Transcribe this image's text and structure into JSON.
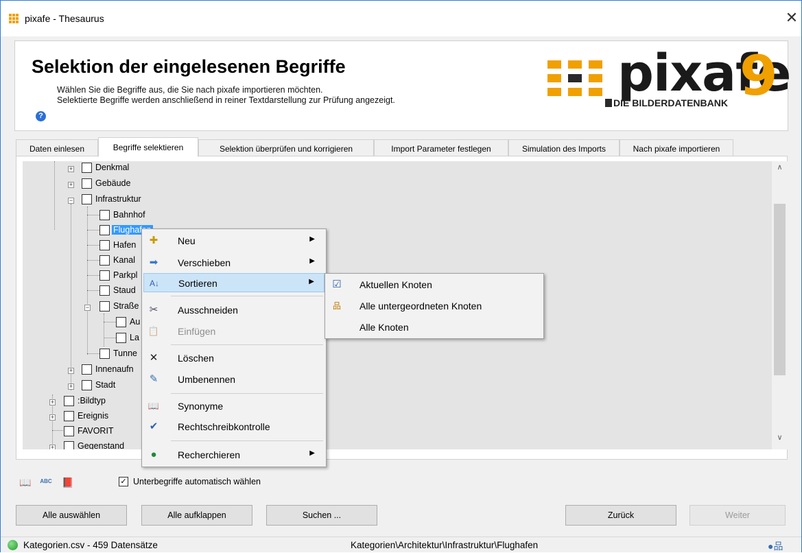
{
  "window": {
    "title": "pixafe - Thesaurus",
    "close_symbol": "✕"
  },
  "header": {
    "title": "Selektion der eingelesenen Begriffe",
    "description_line1": "Wählen Sie die Begriffe aus, die Sie nach pixafe importieren möchten.",
    "description_line2": "Selektierte Begriffe werden anschließend in reiner Textdarstellung zur Prüfung angezeigt.",
    "help_symbol": "?",
    "logo_word": "pixafe",
    "logo_number": "9",
    "logo_subtitle": "DIE BILDERDATENBANK"
  },
  "tabs": [
    {
      "label": "Daten einlesen"
    },
    {
      "label": "Begriffe selektieren",
      "active": true
    },
    {
      "label": "Selektion überprüfen und korrigieren"
    },
    {
      "label": "Import Parameter festlegen"
    },
    {
      "label": "Simulation des Imports"
    },
    {
      "label": "Nach pixafe importieren"
    }
  ],
  "tree": {
    "nodes": [
      {
        "label": "Denkmal",
        "checked": false
      },
      {
        "label": "Gebäude",
        "checked": false
      },
      {
        "label": "Infrastruktur",
        "checked": false
      },
      {
        "label": "Bahnhof",
        "checked": false
      },
      {
        "label": "Flughafen",
        "checked": false,
        "selected": true
      },
      {
        "label": "Hafen",
        "checked": false
      },
      {
        "label": "Kanal",
        "checked": false
      },
      {
        "label": "Parkpl",
        "checked": false
      },
      {
        "label": "Staud",
        "checked": false
      },
      {
        "label": "Straße",
        "checked": false
      },
      {
        "label": "Au",
        "checked": false
      },
      {
        "label": "La",
        "checked": false
      },
      {
        "label": "Tunne",
        "checked": false
      },
      {
        "label": "Innenaufn",
        "checked": false
      },
      {
        "label": "Stadt",
        "checked": false
      },
      {
        "label": ":Bildtyp",
        "checked": false
      },
      {
        "label": "Ereignis",
        "checked": false
      },
      {
        "label": "FAVORIT",
        "checked": false
      },
      {
        "label": "Gegenstand",
        "checked": false
      }
    ]
  },
  "context_menu": {
    "items": [
      {
        "label": "Neu",
        "icon": "new-node-icon",
        "glyph": "✚",
        "submenu": true
      },
      {
        "label": "Verschieben",
        "icon": "move-arrow-icon",
        "glyph": "➡",
        "submenu": true
      },
      {
        "label": "Sortieren",
        "icon": "sort-az-icon",
        "glyph": "A↓",
        "submenu": true,
        "highlighted": true
      },
      {
        "label": "Ausschneiden",
        "icon": "scissors-icon",
        "glyph": "✂"
      },
      {
        "label": "Einfügen",
        "icon": "paste-icon",
        "glyph": "📋",
        "disabled": true
      },
      {
        "label": "Löschen",
        "icon": "delete-x-icon",
        "glyph": "✕"
      },
      {
        "label": "Umbenennen",
        "icon": "rename-pencil-icon",
        "glyph": "✎"
      },
      {
        "label": "Synonyme",
        "icon": "book-icon",
        "glyph": "📖"
      },
      {
        "label": "Rechtschreibkontrolle",
        "icon": "spellcheck-icon",
        "glyph": "✔"
      },
      {
        "label": "Recherchieren",
        "icon": "globe-icon",
        "glyph": "●",
        "submenu": true
      }
    ],
    "submenu_arrow": "▶"
  },
  "sort_submenu": {
    "items": [
      {
        "label": "Aktuellen Knoten",
        "icon": "checkbox-checked-icon",
        "glyph": "☑"
      },
      {
        "label": "Alle untergeordneten Knoten",
        "icon": "hierarchy-icon",
        "glyph": "品"
      },
      {
        "label": "Alle Knoten",
        "icon": "",
        "glyph": ""
      }
    ]
  },
  "toolbar": {
    "icons": [
      {
        "name": "synonyms-book-icon",
        "glyph": "📖"
      },
      {
        "name": "spellcheck-icon",
        "glyph": "ABC"
      },
      {
        "name": "open-book-icon",
        "glyph": "📕"
      }
    ],
    "auto_select_label": "Unterbegriffe automatisch wählen",
    "auto_select_checked": true,
    "check_mark": "✓"
  },
  "buttons": {
    "select_all": "Alle auswählen",
    "expand_all": "Alle aufklappen",
    "search": "Suchen ...",
    "back": "Zurück",
    "next": "Weiter"
  },
  "status": {
    "file_info": "Kategorien.csv - 459 Datensätze",
    "path": "Kategorien\\Architektur\\Infrastruktur\\Flughafen",
    "right_glyph": "●品"
  }
}
